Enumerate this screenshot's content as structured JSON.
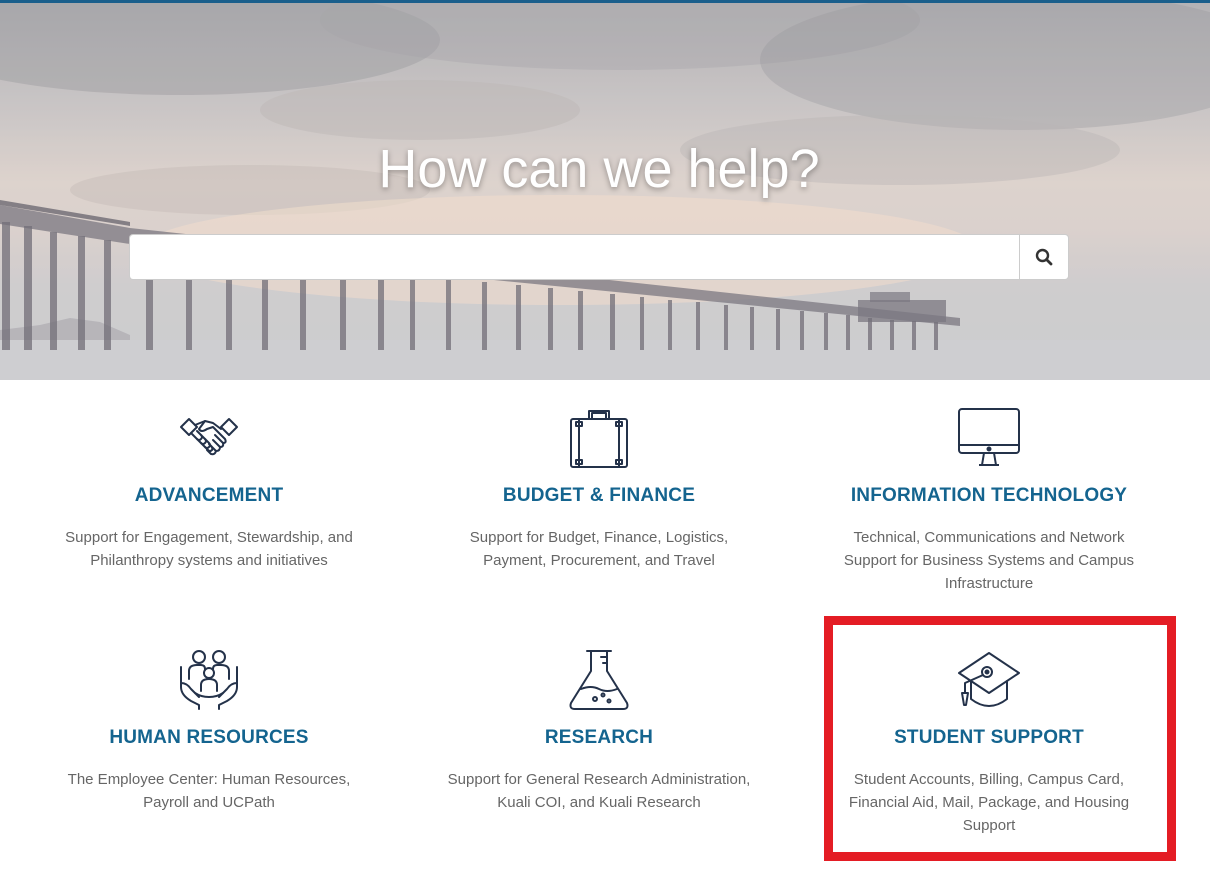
{
  "hero": {
    "title": "How can we help?"
  },
  "search": {
    "placeholder": "",
    "value": "",
    "button_icon": "search-icon"
  },
  "cards": [
    {
      "title": "ADVANCEMENT",
      "description": "Support for Engagement, Stewardship, and Philanthropy systems and initiatives",
      "icon": "handshake-icon"
    },
    {
      "title": "BUDGET & FINANCE",
      "description": "Support for Budget, Finance, Logistics, Payment, Procurement, and Travel",
      "icon": "briefcase-icon"
    },
    {
      "title": "INFORMATION TECHNOLOGY",
      "description": "Technical, Communications and Network Support for Business Systems and Campus Infrastructure",
      "icon": "monitor-icon"
    },
    {
      "title": "HUMAN RESOURCES",
      "description": "The Employee Center: Human Resources, Payroll and UCPath",
      "icon": "family-hands-icon"
    },
    {
      "title": "RESEARCH",
      "description": "Support for General Research Administration, Kuali COI, and Kuali Research",
      "icon": "flask-icon"
    },
    {
      "title": "STUDENT SUPPORT",
      "description": "Student Accounts, Billing, Campus Card, Financial Aid, Mail, Package, and Housing Support",
      "icon": "graduation-cap-icon"
    }
  ],
  "colors": {
    "title_blue": "#14648f",
    "icon_navy": "#24324a",
    "description_gray": "#666666",
    "highlight_red": "#e41c24"
  }
}
